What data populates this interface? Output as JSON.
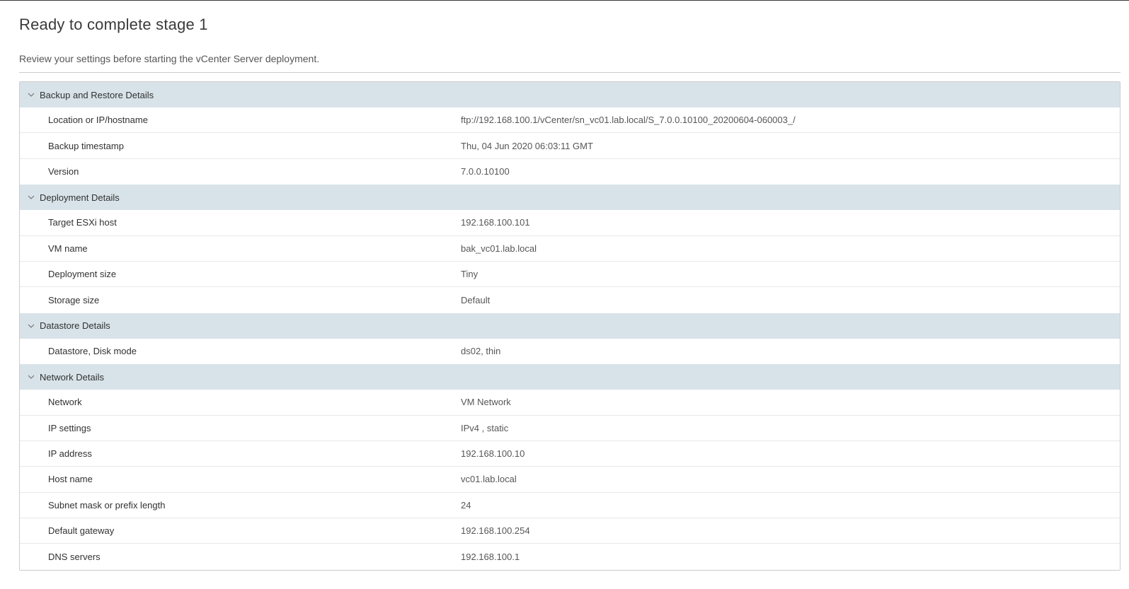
{
  "header": {
    "title": "Ready to complete stage 1",
    "subtitle": "Review your settings before starting the vCenter Server deployment."
  },
  "sections": [
    {
      "title": "Backup and Restore Details",
      "icon": "chevron-down-icon",
      "rows": [
        {
          "label": "Location or IP/hostname",
          "value": "ftp://192.168.100.1/vCenter/sn_vc01.lab.local/S_7.0.0.10100_20200604-060003_/"
        },
        {
          "label": "Backup timestamp",
          "value": "Thu, 04 Jun 2020 06:03:11 GMT"
        },
        {
          "label": "Version",
          "value": "7.0.0.10100"
        }
      ]
    },
    {
      "title": "Deployment Details",
      "icon": "chevron-down-icon",
      "rows": [
        {
          "label": "Target ESXi host",
          "value": "192.168.100.101"
        },
        {
          "label": "VM name",
          "value": "bak_vc01.lab.local"
        },
        {
          "label": "Deployment size",
          "value": "Tiny"
        },
        {
          "label": "Storage size",
          "value": "Default"
        }
      ]
    },
    {
      "title": "Datastore Details",
      "icon": "chevron-down-icon",
      "rows": [
        {
          "label": "Datastore, Disk mode",
          "value": "ds02, thin"
        }
      ]
    },
    {
      "title": "Network Details",
      "icon": "chevron-down-icon",
      "rows": [
        {
          "label": "Network",
          "value": "VM Network"
        },
        {
          "label": "IP settings",
          "value": "IPv4 , static"
        },
        {
          "label": "IP address",
          "value": "192.168.100.10"
        },
        {
          "label": "Host name",
          "value": "vc01.lab.local"
        },
        {
          "label": "Subnet mask or prefix length",
          "value": "24"
        },
        {
          "label": "Default gateway",
          "value": "192.168.100.254"
        },
        {
          "label": "DNS servers",
          "value": "192.168.100.1"
        }
      ]
    }
  ],
  "colors": {
    "section_header_bg": "#d8e3e9",
    "border": "#cccccc",
    "text": "#313131",
    "value_text": "#565656"
  }
}
